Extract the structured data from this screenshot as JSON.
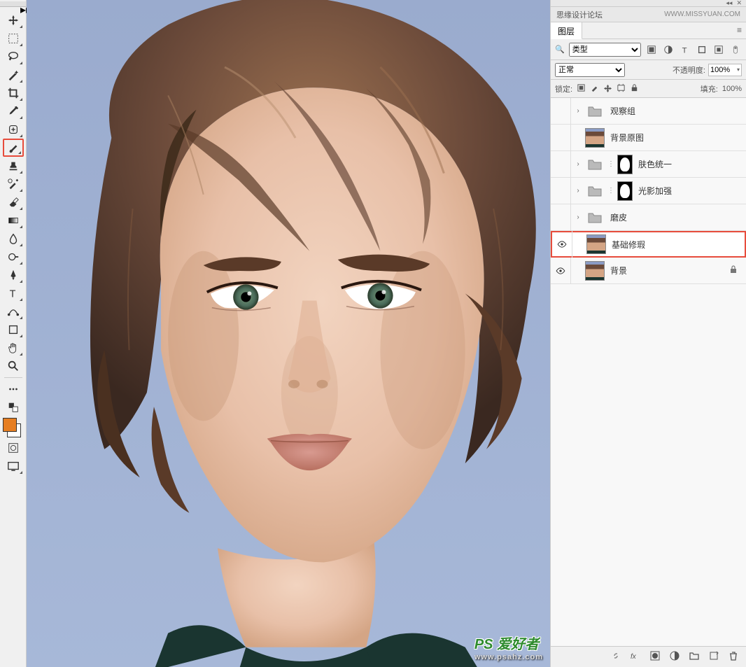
{
  "panel": {
    "forum_text": "思缘设计论坛",
    "forum_url": "WWW.MISSYUAN.COM",
    "tab_label": "图层",
    "filter_label": "类型",
    "blend_mode": "正常",
    "opacity_label": "不透明度:",
    "opacity_value": "100%",
    "lock_label": "锁定:",
    "fill_label": "填充:",
    "fill_value": "100%"
  },
  "layers": [
    {
      "name": "观察组",
      "type": "folder",
      "visible": false,
      "expandable": true
    },
    {
      "name": "背景原图",
      "type": "portrait",
      "visible": false
    },
    {
      "name": "肤色统一",
      "type": "folder-mask",
      "visible": false,
      "expandable": true
    },
    {
      "name": "光影加强",
      "type": "folder-mask",
      "visible": false,
      "expandable": true
    },
    {
      "name": "磨皮",
      "type": "folder",
      "visible": false,
      "expandable": true
    },
    {
      "name": "基础修瑕",
      "type": "portrait",
      "visible": true,
      "selected": true
    },
    {
      "name": "背景",
      "type": "portrait",
      "visible": true,
      "locked": true
    }
  ],
  "watermark": {
    "main": "PS 爱好者",
    "sub": "www.psahz.com"
  }
}
